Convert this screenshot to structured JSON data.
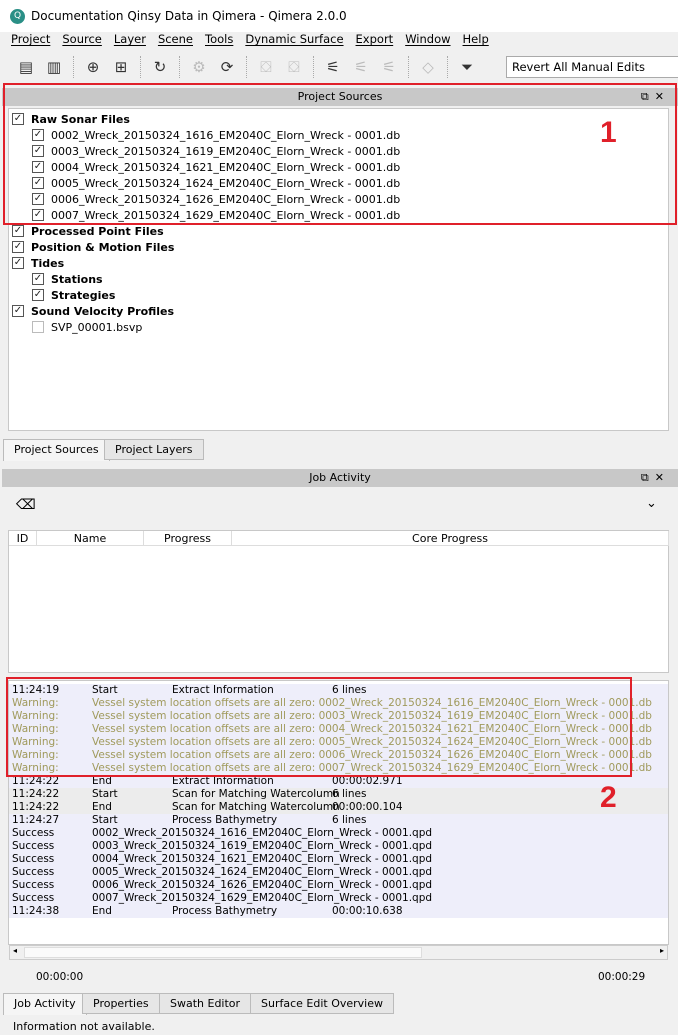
{
  "window": {
    "title": "Documentation Qinsy Data in Qimera - Qimera 2.0.0"
  },
  "menu": [
    "Project",
    "Source",
    "Layer",
    "Scene",
    "Tools",
    "Dynamic Surface",
    "Export",
    "Window",
    "Help"
  ],
  "toolbar": {
    "icons": [
      {
        "name": "new-project-icon",
        "glyph": "▤",
        "disabled": false
      },
      {
        "name": "open-project-icon",
        "glyph": "▥",
        "disabled": false
      },
      {
        "sep": true
      },
      {
        "name": "add-raw-sonar-icon",
        "glyph": "⊕",
        "disabled": false
      },
      {
        "name": "add-point-file-icon",
        "glyph": "⊞",
        "disabled": false
      },
      {
        "sep": true
      },
      {
        "name": "add-svp-icon",
        "glyph": "↻",
        "disabled": false
      },
      {
        "sep": true
      },
      {
        "name": "settings-gears-icon",
        "glyph": "⚙",
        "disabled": true
      },
      {
        "name": "reprocess-icon",
        "glyph": "⟳",
        "disabled": false
      },
      {
        "sep": true
      },
      {
        "name": "vessel-editor-icon",
        "glyph": "⛋",
        "disabled": true
      },
      {
        "name": "lock-icon",
        "glyph": "⛋",
        "disabled": true
      },
      {
        "sep": true
      },
      {
        "name": "sonar-icon",
        "glyph": "⚟",
        "disabled": false
      },
      {
        "name": "swath-icon",
        "glyph": "⚟",
        "disabled": true
      },
      {
        "name": "swath-edit-icon",
        "glyph": "⚟",
        "disabled": true
      },
      {
        "sep": true
      },
      {
        "name": "surface-edit-icon",
        "glyph": "◇",
        "disabled": true
      },
      {
        "sep": true
      },
      {
        "name": "filter-icon",
        "glyph": "⏷",
        "disabled": false
      }
    ],
    "revert_select": "Revert All Manual Edits"
  },
  "project_sources": {
    "title": "Project Sources",
    "tree": [
      {
        "label": "Raw Sonar Files",
        "level": 0,
        "checked": true,
        "bold": true
      },
      {
        "label": "0002_Wreck_20150324_1616_EM2040C_Elorn_Wreck - 0001.db",
        "level": 1,
        "checked": true
      },
      {
        "label": "0003_Wreck_20150324_1619_EM2040C_Elorn_Wreck - 0001.db",
        "level": 1,
        "checked": true
      },
      {
        "label": "0004_Wreck_20150324_1621_EM2040C_Elorn_Wreck - 0001.db",
        "level": 1,
        "checked": true
      },
      {
        "label": "0005_Wreck_20150324_1624_EM2040C_Elorn_Wreck - 0001.db",
        "level": 1,
        "checked": true
      },
      {
        "label": "0006_Wreck_20150324_1626_EM2040C_Elorn_Wreck - 0001.db",
        "level": 1,
        "checked": true
      },
      {
        "label": "0007_Wreck_20150324_1629_EM2040C_Elorn_Wreck - 0001.db",
        "level": 1,
        "checked": true
      },
      {
        "label": "Processed Point Files",
        "level": 0,
        "checked": true,
        "bold": true
      },
      {
        "label": "Position & Motion Files",
        "level": 0,
        "checked": true,
        "bold": true
      },
      {
        "label": "Tides",
        "level": 0,
        "checked": true,
        "bold": true
      },
      {
        "label": "Stations",
        "level": 1,
        "checked": true,
        "bold": true
      },
      {
        "label": "Strategies",
        "level": 1,
        "checked": true,
        "bold": true
      },
      {
        "label": "Sound Velocity Profiles",
        "level": 0,
        "checked": true,
        "bold": true
      },
      {
        "label": "SVP_00001.bsvp",
        "level": 1,
        "checked": false
      }
    ],
    "tabs": [
      "Project Sources",
      "Project Layers"
    ]
  },
  "job_activity": {
    "title": "Job Activity",
    "columns": [
      "ID",
      "Name",
      "Progress",
      "Core Progress"
    ],
    "log": [
      {
        "c": [
          "11:24:19",
          "Start",
          "Extract Information",
          "6 lines"
        ],
        "type": "info",
        "group": "a"
      },
      {
        "c": [
          "Warning:",
          "Vessel system location offsets are all zero: 0002_Wreck_20150324_1616_EM2040C_Elorn_Wreck - 0001.db"
        ],
        "type": "warn",
        "group": "a"
      },
      {
        "c": [
          "Warning:",
          "Vessel system location offsets are all zero: 0003_Wreck_20150324_1619_EM2040C_Elorn_Wreck - 0001.db"
        ],
        "type": "warn",
        "group": "a"
      },
      {
        "c": [
          "Warning:",
          "Vessel system location offsets are all zero: 0004_Wreck_20150324_1621_EM2040C_Elorn_Wreck - 0001.db"
        ],
        "type": "warn",
        "group": "a"
      },
      {
        "c": [
          "Warning:",
          "Vessel system location offsets are all zero: 0005_Wreck_20150324_1624_EM2040C_Elorn_Wreck - 0001.db"
        ],
        "type": "warn",
        "group": "a"
      },
      {
        "c": [
          "Warning:",
          "Vessel system location offsets are all zero: 0006_Wreck_20150324_1626_EM2040C_Elorn_Wreck - 0001.db"
        ],
        "type": "warn",
        "group": "a"
      },
      {
        "c": [
          "Warning:",
          "Vessel system location offsets are all zero: 0007_Wreck_20150324_1629_EM2040C_Elorn_Wreck - 0001.db"
        ],
        "type": "warn",
        "group": "a"
      },
      {
        "c": [
          "11:24:22",
          "End",
          "Extract Information",
          "00:00:02.971"
        ],
        "type": "info",
        "group": "a"
      },
      {
        "c": [
          "11:24:22",
          "Start",
          "Scan for Matching Watercolumn",
          "6 lines"
        ],
        "type": "info",
        "group": "b"
      },
      {
        "c": [
          "11:24:22",
          "End",
          "Scan for Matching Watercolumn",
          "00:00:00.104"
        ],
        "type": "info",
        "group": "b"
      },
      {
        "c": [
          "11:24:27",
          "Start",
          "Process Bathymetry",
          "6 lines"
        ],
        "type": "info",
        "group": "a"
      },
      {
        "c": [
          "Success",
          "0002_Wreck_20150324_1616_EM2040C_Elorn_Wreck - 0001.qpd"
        ],
        "type": "info",
        "group": "a"
      },
      {
        "c": [
          "Success",
          "0003_Wreck_20150324_1619_EM2040C_Elorn_Wreck - 0001.qpd"
        ],
        "type": "info",
        "group": "a"
      },
      {
        "c": [
          "Success",
          "0004_Wreck_20150324_1621_EM2040C_Elorn_Wreck - 0001.qpd"
        ],
        "type": "info",
        "group": "a"
      },
      {
        "c": [
          "Success",
          "0005_Wreck_20150324_1624_EM2040C_Elorn_Wreck - 0001.qpd"
        ],
        "type": "info",
        "group": "a"
      },
      {
        "c": [
          "Success",
          "0006_Wreck_20150324_1626_EM2040C_Elorn_Wreck - 0001.qpd"
        ],
        "type": "info",
        "group": "a"
      },
      {
        "c": [
          "Success",
          "0007_Wreck_20150324_1629_EM2040C_Elorn_Wreck - 0001.qpd"
        ],
        "type": "info",
        "group": "a"
      },
      {
        "c": [
          "11:24:38",
          "End",
          "Process Bathymetry",
          "00:00:10.638"
        ],
        "type": "info",
        "group": "a"
      }
    ],
    "time_start": "00:00:00",
    "time_end": "00:00:29",
    "tabs": [
      "Job Activity",
      "Properties",
      "Swath Editor",
      "Surface Edit Overview"
    ]
  },
  "status": "Information not available.",
  "annotations": [
    "1",
    "2"
  ],
  "colors": {
    "warning": "#a09a5c",
    "group_a": "#eeeefa",
    "group_b": "#ececec",
    "highlight": "#e0202a"
  }
}
